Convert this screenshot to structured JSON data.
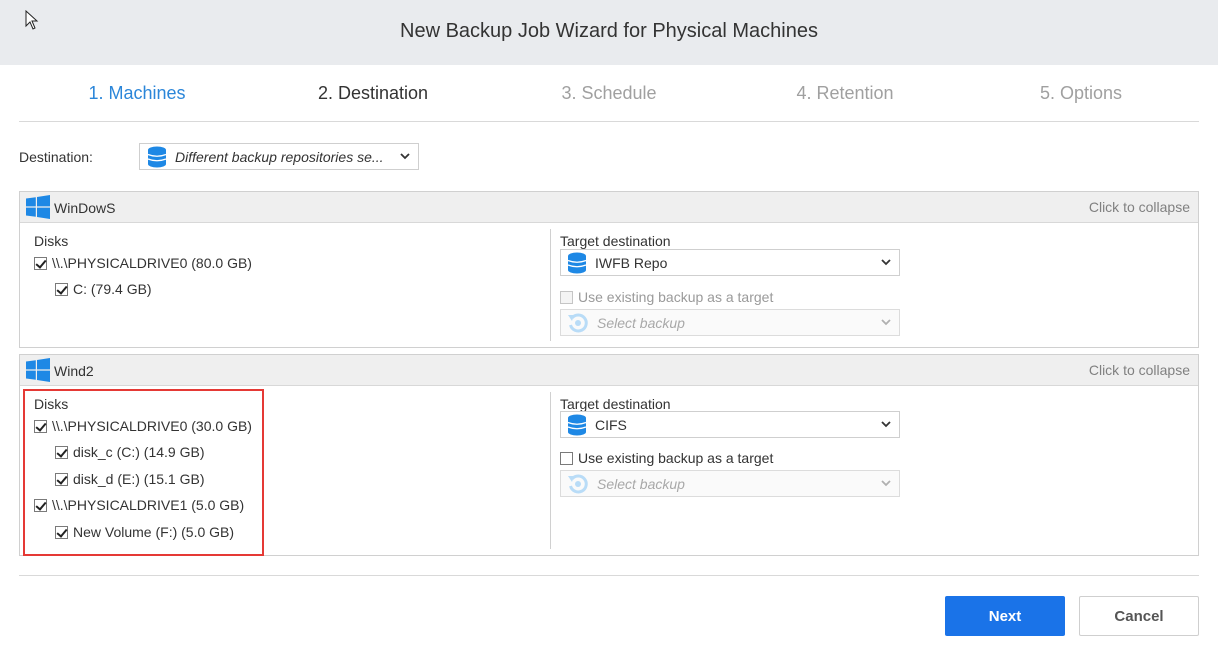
{
  "window": {
    "title": "New Backup Job Wizard for Physical Machines"
  },
  "tabs": [
    {
      "label": "1. Machines",
      "state": "active"
    },
    {
      "label": "2. Destination",
      "state": "current"
    },
    {
      "label": "3. Schedule",
      "state": "disabled"
    },
    {
      "label": "4. Retention",
      "state": "disabled"
    },
    {
      "label": "5. Options",
      "state": "disabled"
    }
  ],
  "destination": {
    "label": "Destination:",
    "value": "Different backup repositories se..."
  },
  "machines": [
    {
      "name": "WinDowS",
      "collapse_label": "Click to collapse",
      "disks_label": "Disks",
      "disks": [
        {
          "label": "\\\\.\\PHYSICALDRIVE0 (80.0 GB)",
          "checked": true,
          "level": 0
        },
        {
          "label": "C: (79.4 GB)",
          "checked": true,
          "level": 1
        }
      ],
      "target_label": "Target destination",
      "target_value": "IWFB Repo",
      "use_existing_label": "Use existing backup as a target",
      "use_existing_enabled": false,
      "backup_placeholder": "Select backup"
    },
    {
      "name": "Wind2",
      "collapse_label": "Click to collapse",
      "disks_label": "Disks",
      "disks": [
        {
          "label": "\\\\.\\PHYSICALDRIVE0 (30.0 GB)",
          "checked": true,
          "level": 0
        },
        {
          "label": "disk_c (C:) (14.9 GB)",
          "checked": true,
          "level": 1
        },
        {
          "label": "disk_d (E:) (15.1 GB)",
          "checked": true,
          "level": 1
        },
        {
          "label": "\\\\.\\PHYSICALDRIVE1 (5.0 GB)",
          "checked": true,
          "level": 0
        },
        {
          "label": "New Volume (F:) (5.0 GB)",
          "checked": true,
          "level": 1
        }
      ],
      "target_label": "Target destination",
      "target_value": "CIFS",
      "use_existing_label": "Use existing backup as a target",
      "use_existing_enabled": true,
      "backup_placeholder": "Select backup"
    }
  ],
  "buttons": {
    "next": "Next",
    "cancel": "Cancel"
  },
  "colors": {
    "accent": "#1a73e8",
    "tab_active": "#2b86d9",
    "highlight": "#e53935",
    "repo_icon": "#1e88e5"
  }
}
